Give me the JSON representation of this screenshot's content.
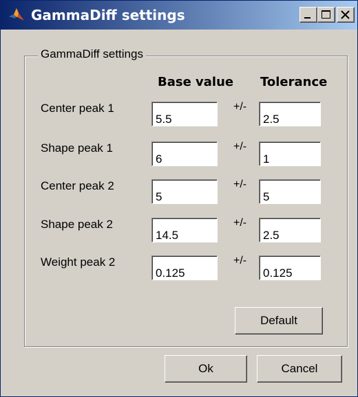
{
  "window": {
    "title": "GammaDiff settings"
  },
  "group": {
    "label": "GammaDiff settings",
    "headers": {
      "base": "Base value",
      "tolerance": "Tolerance"
    },
    "plusminus": "+/-",
    "rows": [
      {
        "label": "Center peak 1",
        "base": "5.5",
        "tolerance": "2.5"
      },
      {
        "label": "Shape peak 1",
        "base": "6",
        "tolerance": "1"
      },
      {
        "label": "Center peak 2",
        "base": "5",
        "tolerance": "5"
      },
      {
        "label": "Shape peak 2",
        "base": "14.5",
        "tolerance": "2.5"
      },
      {
        "label": "Weight peak 2",
        "base": "0.125",
        "tolerance": "0.125"
      }
    ],
    "default_label": "Default"
  },
  "footer": {
    "ok_label": "Ok",
    "cancel_label": "Cancel"
  },
  "icons": {
    "app": "matlab-icon",
    "minimize": "minimize-icon",
    "maximize": "maximize-icon",
    "close": "close-icon"
  },
  "colors": {
    "titlebar_start": "#0a246a",
    "titlebar_end": "#a6caf0",
    "face": "#d4d0c8"
  }
}
